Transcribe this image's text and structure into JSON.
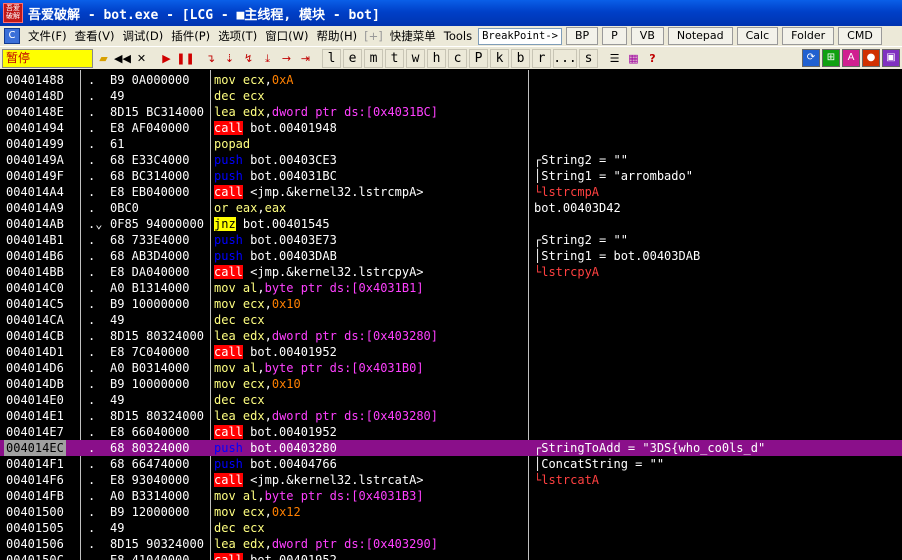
{
  "title": {
    "logo_text": "吾爱破解",
    "text": "吾爱破解 - bot.exe - [LCG - ■主线程, 模块 - bot]"
  },
  "menu": {
    "items": [
      "文件(F)",
      "查看(V)",
      "调试(D)",
      "插件(P)",
      "选项(T)",
      "窗口(W)",
      "帮助(H)"
    ],
    "plus_label": "[+]",
    "extra_items": [
      "快捷菜单",
      "Tools"
    ],
    "breakpoint_label": "BreakPoint->",
    "buttons": [
      "BP",
      "P",
      "VB",
      "Notepad",
      "Calc",
      "Folder",
      "CMD"
    ]
  },
  "toolbar": {
    "status": "暂停",
    "letters": [
      "l",
      "e",
      "m",
      "t",
      "w",
      "h",
      "c",
      "P",
      "k",
      "b",
      "r",
      "...",
      "s"
    ]
  },
  "colors": {
    "mov": "#ffff80",
    "dec": "#ffff80",
    "lea": "#ffff80",
    "push": "#0000ff",
    "call_bg": "#ff0000",
    "jnz_bg": "#ffff00",
    "or": "#ffff80",
    "popad": "#ffff80",
    "operand_reg": "#ffff80",
    "operand_mem": "#ff40ff",
    "number": "#ff8000",
    "label": "#ffffff",
    "comment": "#ffffff",
    "comment_red": "#ff4040",
    "selected_row": "#8a0f8a"
  },
  "rows": [
    {
      "addr": "00401488",
      "mark": ".",
      "hex": "B9 0A000000",
      "asm": [
        [
          "mov",
          "mov"
        ],
        [
          "reg",
          "ecx"
        ],
        [
          "plain",
          ","
        ],
        [
          "num",
          "0xA"
        ]
      ],
      "comment": ""
    },
    {
      "addr": "0040148D",
      "mark": ".",
      "hex": "49",
      "asm": [
        [
          "dec",
          "dec"
        ],
        [
          "reg",
          "ecx"
        ]
      ],
      "comment": ""
    },
    {
      "addr": "0040148E",
      "mark": ".",
      "hex": "8D15 BC314000",
      "asm": [
        [
          "lea",
          "lea"
        ],
        [
          "reg",
          "edx"
        ],
        [
          "plain",
          ","
        ],
        [
          "mem",
          "dword ptr ds:[0x4031BC]"
        ]
      ],
      "comment": ""
    },
    {
      "addr": "00401494",
      "mark": ".",
      "hex": "E8 AF040000",
      "asm": [
        [
          "call",
          "call"
        ],
        [
          "label",
          "bot.00401948"
        ]
      ],
      "comment": ""
    },
    {
      "addr": "00401499",
      "mark": ".",
      "hex": "61",
      "asm": [
        [
          "popad",
          "popad"
        ]
      ],
      "comment": ""
    },
    {
      "addr": "0040149A",
      "mark": ".",
      "hex": "68 E33C4000",
      "asm": [
        [
          "push",
          "push"
        ],
        [
          "label",
          "bot.00403CE3"
        ]
      ],
      "comment": "┌String2 = \"\""
    },
    {
      "addr": "0040149F",
      "mark": ".",
      "hex": "68 BC314000",
      "asm": [
        [
          "push",
          "push"
        ],
        [
          "label",
          "bot.004031BC"
        ]
      ],
      "comment": "│String1 = \"arrombado\""
    },
    {
      "addr": "004014A4",
      "mark": ".",
      "hex": "E8 EB040000",
      "asm": [
        [
          "call",
          "call"
        ],
        [
          "label",
          "<jmp.&kernel32.lstrcmpA>"
        ]
      ],
      "comment": "└lstrcmpA",
      "comment_red": true
    },
    {
      "addr": "004014A9",
      "mark": ".",
      "hex": "0BC0",
      "asm": [
        [
          "or",
          "or"
        ],
        [
          "reg",
          "eax"
        ],
        [
          "plain",
          ","
        ],
        [
          "reg",
          "eax"
        ]
      ],
      "comment": "bot.00403D42"
    },
    {
      "addr": "004014AB",
      "mark": ".⌄",
      "hex": "0F85 94000000",
      "asm": [
        [
          "jnz",
          "jnz"
        ],
        [
          "label",
          "bot.00401545"
        ]
      ],
      "comment": ""
    },
    {
      "addr": "004014B1",
      "mark": ".",
      "hex": "68 733E4000",
      "asm": [
        [
          "push",
          "push"
        ],
        [
          "label",
          "bot.00403E73"
        ]
      ],
      "comment": "┌String2 = \"\""
    },
    {
      "addr": "004014B6",
      "mark": ".",
      "hex": "68 AB3D4000",
      "asm": [
        [
          "push",
          "push"
        ],
        [
          "label",
          "bot.00403DAB"
        ]
      ],
      "comment": "│String1 = bot.00403DAB"
    },
    {
      "addr": "004014BB",
      "mark": ".",
      "hex": "E8 DA040000",
      "asm": [
        [
          "call",
          "call"
        ],
        [
          "label",
          "<jmp.&kernel32.lstrcpyA>"
        ]
      ],
      "comment": "└lstrcpyA",
      "comment_red": true
    },
    {
      "addr": "004014C0",
      "mark": ".",
      "hex": "A0 B1314000",
      "asm": [
        [
          "mov",
          "mov"
        ],
        [
          "reg",
          "al"
        ],
        [
          "plain",
          ","
        ],
        [
          "mem",
          "byte ptr ds:[0x4031B1]"
        ]
      ],
      "comment": ""
    },
    {
      "addr": "004014C5",
      "mark": ".",
      "hex": "B9 10000000",
      "asm": [
        [
          "mov",
          "mov"
        ],
        [
          "reg",
          "ecx"
        ],
        [
          "plain",
          ","
        ],
        [
          "num",
          "0x10"
        ]
      ],
      "comment": ""
    },
    {
      "addr": "004014CA",
      "mark": ".",
      "hex": "49",
      "asm": [
        [
          "dec",
          "dec"
        ],
        [
          "reg",
          "ecx"
        ]
      ],
      "comment": ""
    },
    {
      "addr": "004014CB",
      "mark": ".",
      "hex": "8D15 80324000",
      "asm": [
        [
          "lea",
          "lea"
        ],
        [
          "reg",
          "edx"
        ],
        [
          "plain",
          ","
        ],
        [
          "mem",
          "dword ptr ds:[0x403280]"
        ]
      ],
      "comment": ""
    },
    {
      "addr": "004014D1",
      "mark": ".",
      "hex": "E8 7C040000",
      "asm": [
        [
          "call",
          "call"
        ],
        [
          "label",
          "bot.00401952"
        ]
      ],
      "comment": ""
    },
    {
      "addr": "004014D6",
      "mark": ".",
      "hex": "A0 B0314000",
      "asm": [
        [
          "mov",
          "mov"
        ],
        [
          "reg",
          "al"
        ],
        [
          "plain",
          ","
        ],
        [
          "mem",
          "byte ptr ds:[0x4031B0]"
        ]
      ],
      "comment": ""
    },
    {
      "addr": "004014DB",
      "mark": ".",
      "hex": "B9 10000000",
      "asm": [
        [
          "mov",
          "mov"
        ],
        [
          "reg",
          "ecx"
        ],
        [
          "plain",
          ","
        ],
        [
          "num",
          "0x10"
        ]
      ],
      "comment": ""
    },
    {
      "addr": "004014E0",
      "mark": ".",
      "hex": "49",
      "asm": [
        [
          "dec",
          "dec"
        ],
        [
          "reg",
          "ecx"
        ]
      ],
      "comment": ""
    },
    {
      "addr": "004014E1",
      "mark": ".",
      "hex": "8D15 80324000",
      "asm": [
        [
          "lea",
          "lea"
        ],
        [
          "reg",
          "edx"
        ],
        [
          "plain",
          ","
        ],
        [
          "mem",
          "dword ptr ds:[0x403280]"
        ]
      ],
      "comment": ""
    },
    {
      "addr": "004014E7",
      "mark": ".",
      "hex": "E8 66040000",
      "asm": [
        [
          "call",
          "call"
        ],
        [
          "label",
          "bot.00401952"
        ]
      ],
      "comment": ""
    },
    {
      "addr": "004014EC",
      "mark": ".",
      "hex": "68 80324000",
      "asm": [
        [
          "push",
          "push"
        ],
        [
          "label",
          "bot.00403280"
        ]
      ],
      "comment": "┌StringToAdd = \"3DS{who_co0ls_d\"",
      "selected": true
    },
    {
      "addr": "004014F1",
      "mark": ".",
      "hex": "68 66474000",
      "asm": [
        [
          "push",
          "push"
        ],
        [
          "label",
          "bot.00404766"
        ]
      ],
      "comment": "│ConcatString = \"\""
    },
    {
      "addr": "004014F6",
      "mark": ".",
      "hex": "E8 93040000",
      "asm": [
        [
          "call",
          "call"
        ],
        [
          "label",
          "<jmp.&kernel32.lstrcatA>"
        ]
      ],
      "comment": "└lstrcatA",
      "comment_red": true
    },
    {
      "addr": "004014FB",
      "mark": ".",
      "hex": "A0 B3314000",
      "asm": [
        [
          "mov",
          "mov"
        ],
        [
          "reg",
          "al"
        ],
        [
          "plain",
          ","
        ],
        [
          "mem",
          "byte ptr ds:[0x4031B3]"
        ]
      ],
      "comment": ""
    },
    {
      "addr": "00401500",
      "mark": ".",
      "hex": "B9 12000000",
      "asm": [
        [
          "mov",
          "mov"
        ],
        [
          "reg",
          "ecx"
        ],
        [
          "plain",
          ","
        ],
        [
          "num",
          "0x12"
        ]
      ],
      "comment": ""
    },
    {
      "addr": "00401505",
      "mark": ".",
      "hex": "49",
      "asm": [
        [
          "dec",
          "dec"
        ],
        [
          "reg",
          "ecx"
        ]
      ],
      "comment": ""
    },
    {
      "addr": "00401506",
      "mark": ".",
      "hex": "8D15 90324000",
      "asm": [
        [
          "lea",
          "lea"
        ],
        [
          "reg",
          "edx"
        ],
        [
          "plain",
          ","
        ],
        [
          "mem",
          "dword ptr ds:[0x403290]"
        ]
      ],
      "comment": ""
    },
    {
      "addr": "0040150C",
      "mark": ".",
      "hex": "E8 41040000",
      "asm": [
        [
          "call",
          "call"
        ],
        [
          "label",
          "bot.00401952"
        ]
      ],
      "comment": ""
    }
  ]
}
